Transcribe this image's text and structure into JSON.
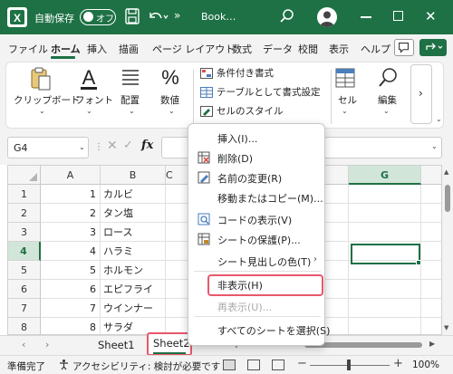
{
  "titlebar": {
    "autosave_label": "自動保存",
    "autosave_state": "オフ",
    "more": "»",
    "doc_title": "Book…",
    "close_glyph": "✕"
  },
  "menu": {
    "tabs": [
      "ファイル",
      "ホーム",
      "挿入",
      "描画",
      "ページ レイアウト",
      "数式",
      "データ",
      "校閲",
      "表示",
      "ヘルプ"
    ],
    "active": "ホーム"
  },
  "ribbon": {
    "clipboard": "クリップボード",
    "font": "フォント",
    "alignment": "配置",
    "number": "数値",
    "cond_format": "条件付き書式",
    "table_format": "テーブルとして書式設定",
    "cell_style": "セルのスタイル",
    "cells": "セル",
    "editing": "編集",
    "more": "›",
    "chevron": "⌄"
  },
  "formula_bar": {
    "name_box": "G4",
    "fx": "fx",
    "cancel": "✕",
    "enter": "✓",
    "dots": "⋮"
  },
  "grid": {
    "columns": [
      "A",
      "B",
      "C",
      "G"
    ],
    "rows": [
      {
        "n": "1",
        "a": "1",
        "b": "カルビ"
      },
      {
        "n": "2",
        "a": "2",
        "b": "タン塩"
      },
      {
        "n": "3",
        "a": "3",
        "b": "ロース"
      },
      {
        "n": "4",
        "a": "4",
        "b": "ハラミ"
      },
      {
        "n": "5",
        "a": "5",
        "b": "ホルモン"
      },
      {
        "n": "6",
        "a": "6",
        "b": "エピフライ"
      },
      {
        "n": "7",
        "a": "7",
        "b": "ウインナー"
      },
      {
        "n": "8",
        "a": "8",
        "b": "サラダ"
      }
    ],
    "selected_cell": "G4"
  },
  "context_menu": {
    "items": [
      {
        "label": "挿入(I)...",
        "icon": "none",
        "enabled": true
      },
      {
        "label": "削除(D)",
        "icon": "delete-sheet-icon",
        "enabled": true
      },
      {
        "label": "名前の変更(R)",
        "icon": "rename-icon",
        "enabled": true
      },
      {
        "label": "移動またはコピー(M)...",
        "icon": "none",
        "enabled": true
      },
      {
        "label": "コードの表示(V)",
        "icon": "view-code-icon",
        "enabled": true
      },
      {
        "label": "シートの保護(P)...",
        "icon": "protect-sheet-icon",
        "enabled": true
      },
      {
        "label": "シート見出しの色(T)",
        "icon": "none",
        "enabled": true,
        "submenu": true
      },
      {
        "label": "非表示(H)",
        "icon": "none",
        "enabled": true,
        "highlighted": true
      },
      {
        "label": "再表示(U)...",
        "icon": "none",
        "enabled": false
      },
      {
        "label": "すべてのシートを選択(S)",
        "icon": "none",
        "enabled": true
      }
    ],
    "submenu_arrow": "›"
  },
  "sheets": {
    "tabs": [
      "Sheet1",
      "Sheet2"
    ],
    "active": "Sheet2",
    "nav_prev": "‹",
    "nav_next": "›",
    "add": "+"
  },
  "status": {
    "ready": "準備完了",
    "accessibility": "アクセシビリティ: 検討が必要です",
    "zoom": "100%",
    "zoom_minus": "−",
    "zoom_plus": "+"
  },
  "colors": {
    "brand": "#1e7145",
    "highlight": "#e8586b"
  }
}
